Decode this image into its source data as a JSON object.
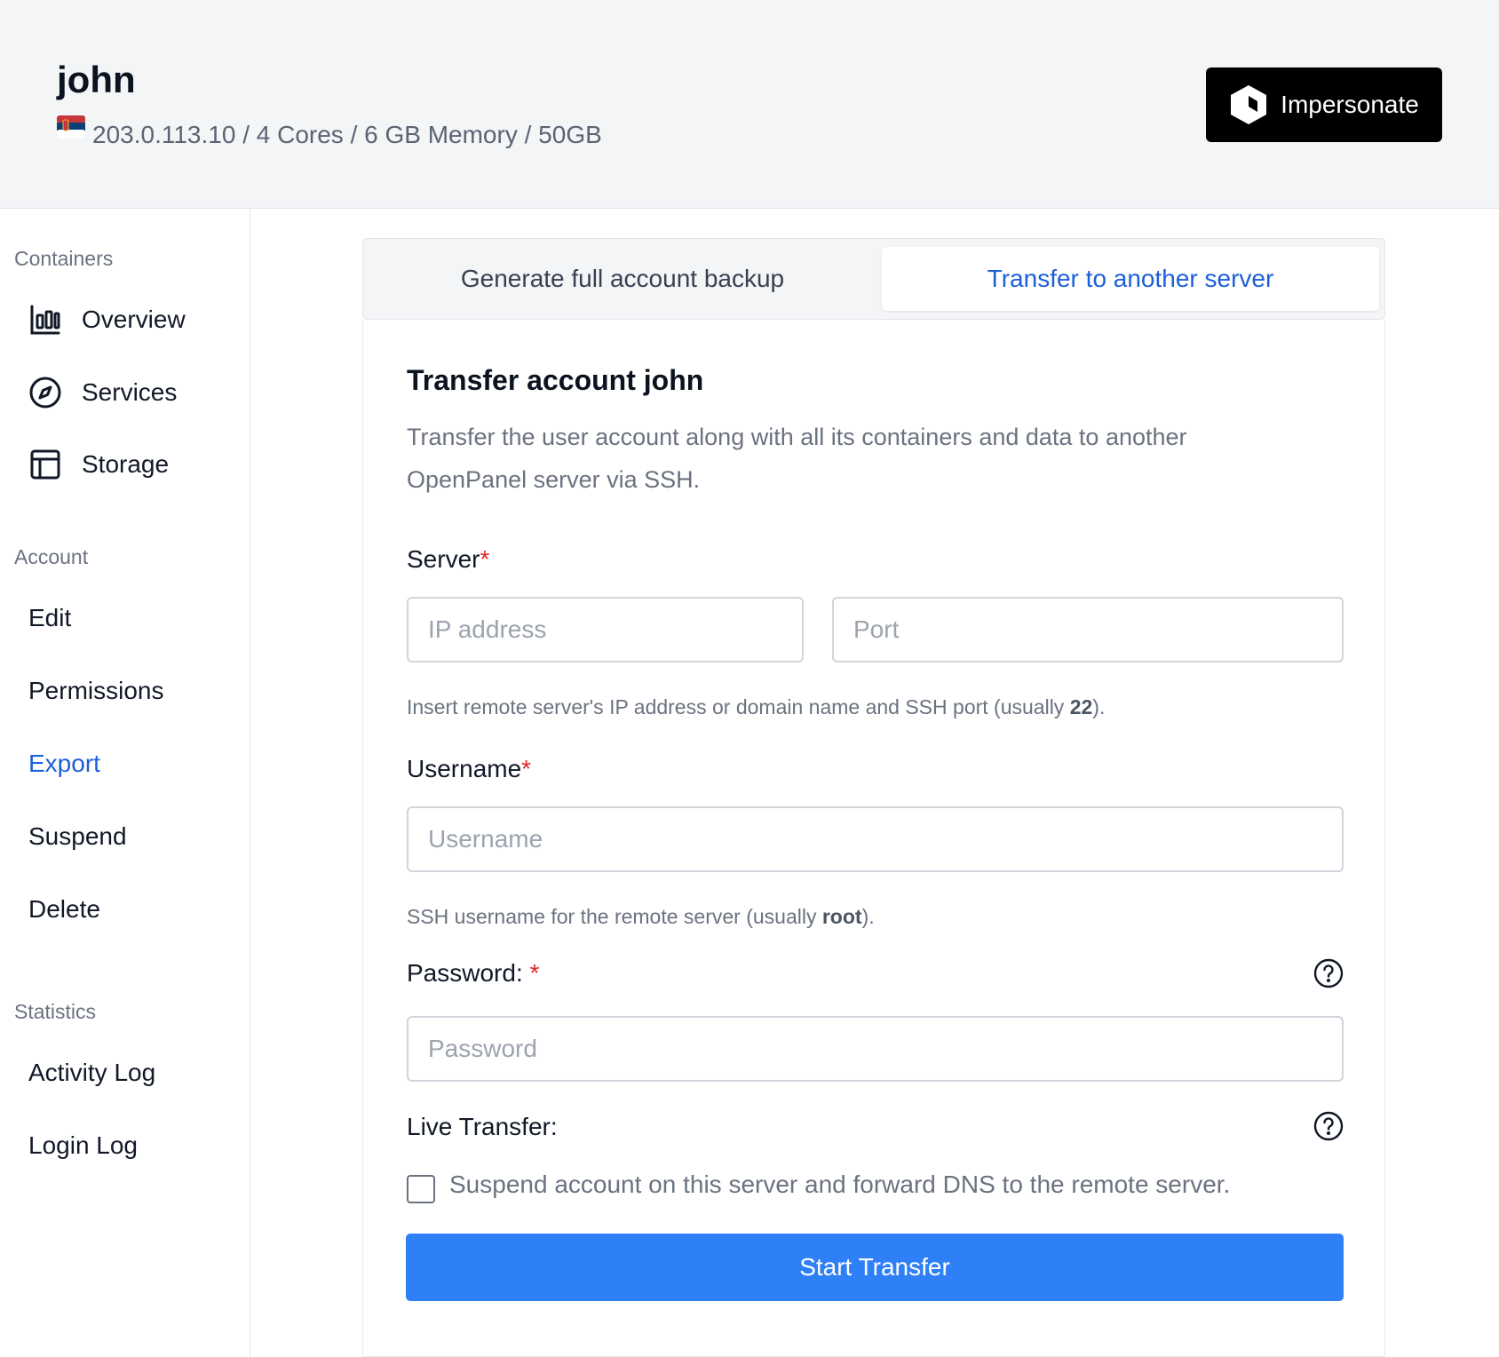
{
  "header": {
    "username": "john",
    "specs": "203.0.113.10 / 4 Cores / 6 GB Memory / 50GB",
    "impersonate_label": "Impersonate"
  },
  "sidebar": {
    "sections": [
      {
        "heading": "Containers",
        "items": [
          {
            "label": "Overview",
            "icon": "bar-chart-icon"
          },
          {
            "label": "Services",
            "icon": "compass-icon"
          },
          {
            "label": "Storage",
            "icon": "table-icon"
          }
        ]
      },
      {
        "heading": "Account",
        "items": [
          {
            "label": "Edit"
          },
          {
            "label": "Permissions"
          },
          {
            "label": "Export",
            "active": true
          },
          {
            "label": "Suspend"
          },
          {
            "label": "Delete"
          }
        ]
      },
      {
        "heading": "Statistics",
        "items": [
          {
            "label": "Activity Log"
          },
          {
            "label": "Login Log"
          }
        ]
      }
    ]
  },
  "tabs": [
    {
      "label": "Generate full account backup"
    },
    {
      "label": "Transfer to another server",
      "active": true
    }
  ],
  "form": {
    "title": "Transfer account john",
    "description": "Transfer the user account along with all its containers and data to another OpenPanel server via SSH.",
    "server_label": "Server",
    "ip_placeholder": "IP address",
    "port_placeholder": "Port",
    "server_help_prefix": "Insert remote server's IP address or domain name and SSH port (usually ",
    "server_help_bold": "22",
    "server_help_suffix": ").",
    "username_label": "Username",
    "username_placeholder": "Username",
    "username_help_prefix": "SSH username for the remote server (usually ",
    "username_help_bold": "root",
    "username_help_suffix": ").",
    "password_label": "Password: ",
    "password_placeholder": "Password",
    "live_label": "Live Transfer:",
    "live_checkbox_label": "Suspend account on this server and forward DNS to the remote server.",
    "required_mark": "*",
    "submit_label": "Start Transfer"
  },
  "colors": {
    "accent": "#2f7ff7",
    "link": "#1d5fd8",
    "required": "#dc2626"
  }
}
